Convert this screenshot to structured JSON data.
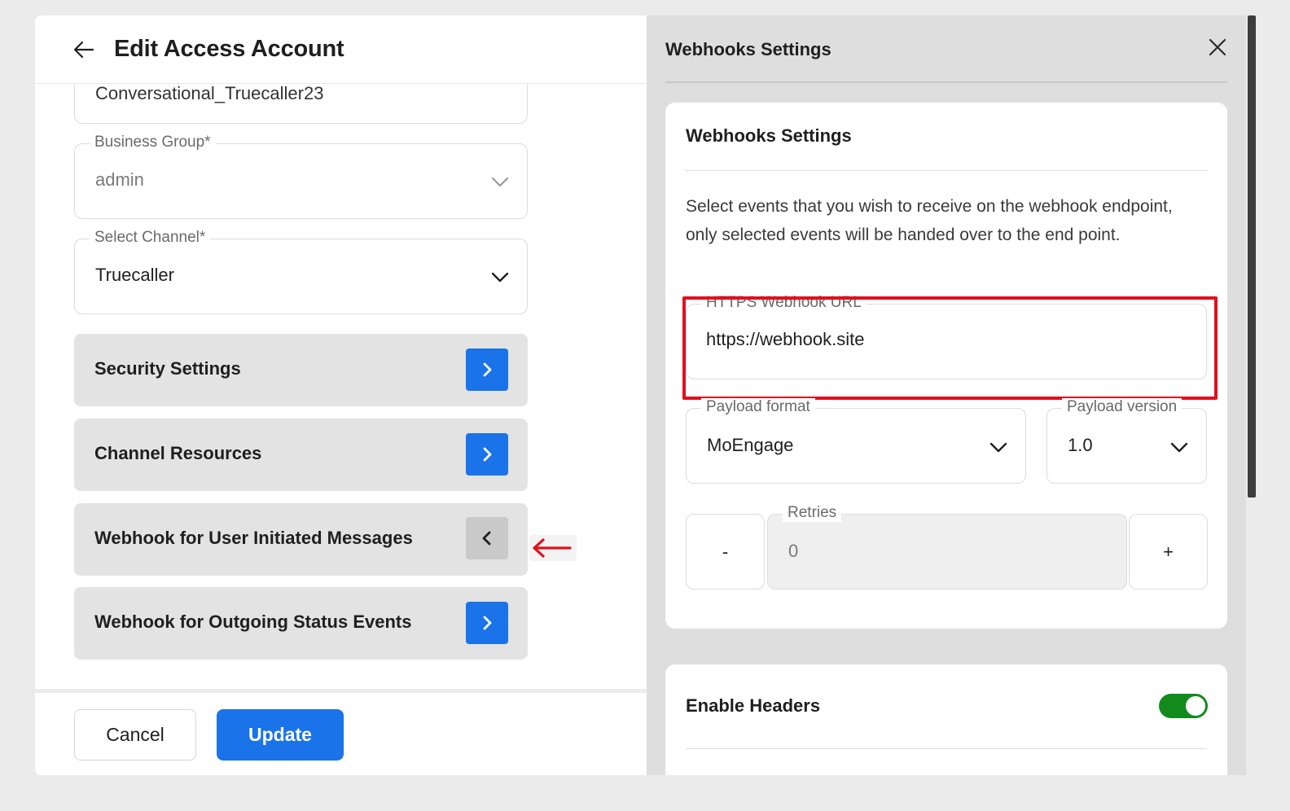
{
  "left": {
    "title": "Edit Access Account",
    "account_name": "Conversational_Truecaller23",
    "business_group": {
      "label": "Business Group*",
      "value": "admin"
    },
    "channel": {
      "label": "Select Channel*",
      "value": "Truecaller"
    },
    "sections": [
      {
        "label": "Security Settings",
        "state": "collapsed-right"
      },
      {
        "label": "Channel Resources",
        "state": "collapsed-right"
      },
      {
        "label": "Webhook for User Initiated Messages",
        "state": "expanded"
      },
      {
        "label": "Webhook for Outgoing Status Events",
        "state": "collapsed-right"
      }
    ],
    "cancel_label": "Cancel",
    "update_label": "Update"
  },
  "right": {
    "panel_title": "Webhooks Settings",
    "card": {
      "title": "Webhooks Settings",
      "description": "Select events that you wish to receive on the webhook endpoint, only selected events will be handed over to the end point.",
      "url_label": "HTTPS Webhook URL",
      "url_value": "https://webhook.site",
      "payload_format_label": "Payload format",
      "payload_format_value": "MoEngage",
      "payload_version_label": "Payload version",
      "payload_version_value": "1.0",
      "retries_label": "Retries",
      "retries_value": "0",
      "minus_label": "-",
      "plus_label": "+"
    },
    "headers_card": {
      "title": "Enable Headers",
      "toggle_on": true
    }
  },
  "colors": {
    "accent": "#1a73e8",
    "highlight": "#e0101e",
    "toggle": "#128a1c"
  },
  "icons": {
    "back": "arrow-left-icon",
    "chevron": "chevron-down-icon",
    "arrow_right": "chevron-right-icon",
    "arrow_left": "chevron-left-icon",
    "close": "close-icon",
    "annotation": "red-arrow-icon"
  }
}
